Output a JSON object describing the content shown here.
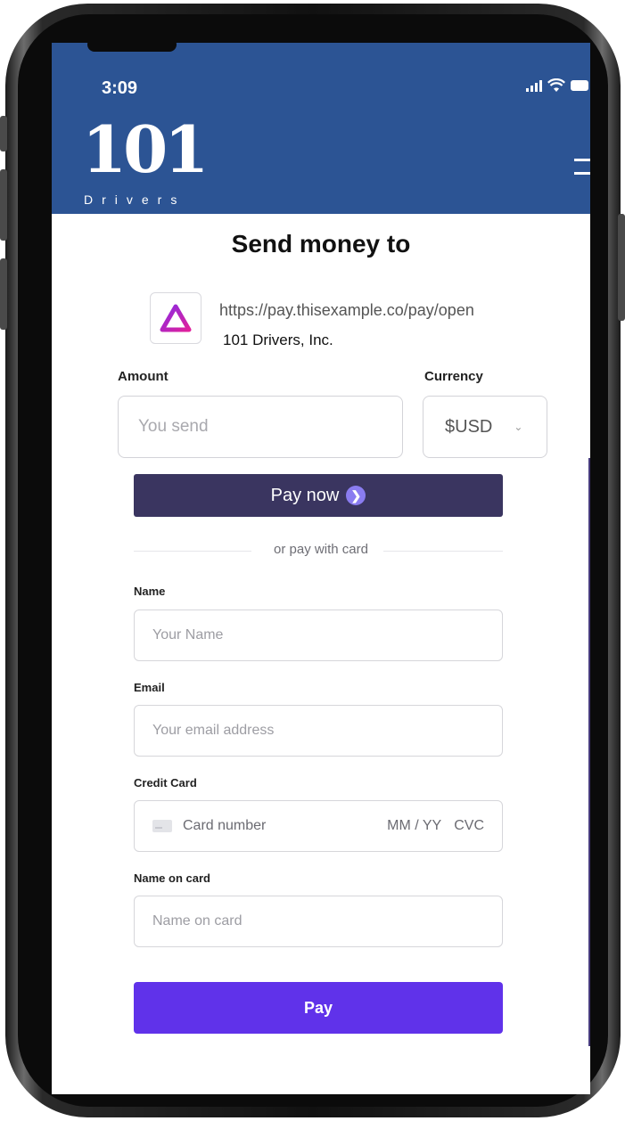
{
  "status_bar": {
    "time": "3:09"
  },
  "brand": {
    "logo_number": "101",
    "logo_word": "Drivers"
  },
  "page": {
    "title": "Send money to"
  },
  "merchant": {
    "url": "https://pay.thisexample.co/pay/open",
    "name": "101 Drivers, Inc."
  },
  "amount": {
    "label": "Amount",
    "placeholder": "You send"
  },
  "currency": {
    "label": "Currency",
    "value": "$USD"
  },
  "pay_now": {
    "label": "Pay now"
  },
  "divider": {
    "text": "or pay with card"
  },
  "form": {
    "name_label": "Name",
    "name_placeholder": "Your Name",
    "email_label": "Email",
    "email_placeholder": "Your email address",
    "card_label": "Credit Card",
    "card_number": "Card number",
    "card_expiry": "MM / YY",
    "card_cvc": "CVC",
    "name_on_card_label": "Name on card",
    "name_on_card_placeholder": "Name on card"
  },
  "pay_button": {
    "label": "Pay"
  },
  "colors": {
    "header": "#2c5494",
    "pay_now_bg": "#3a3560",
    "pay_button_bg": "#6032ea",
    "accent_icon": "#8a7cf0"
  }
}
